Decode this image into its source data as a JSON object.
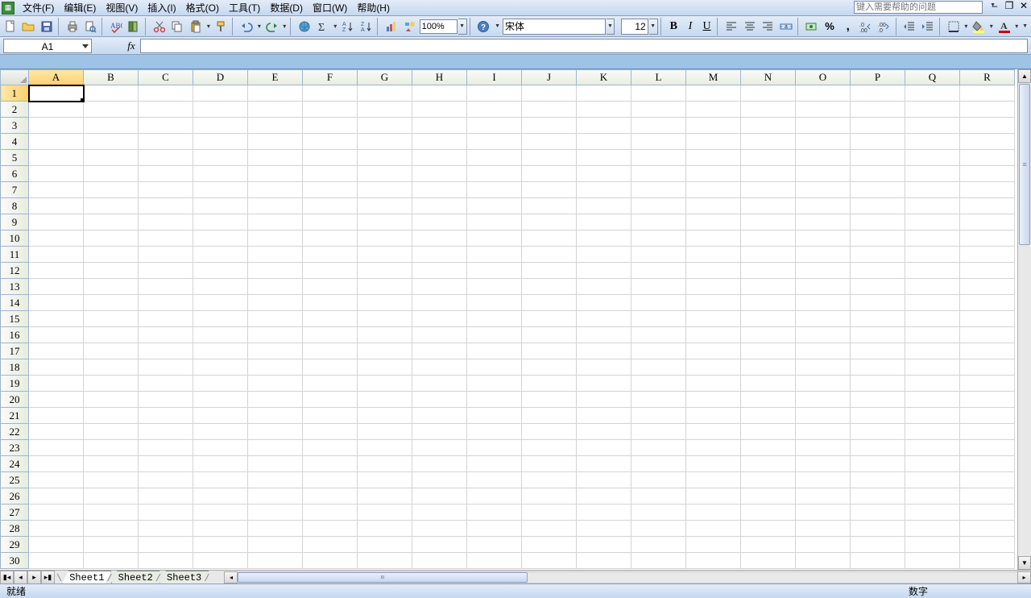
{
  "menu": {
    "items": [
      "文件(F)",
      "编辑(E)",
      "视图(V)",
      "插入(I)",
      "格式(O)",
      "工具(T)",
      "数据(D)",
      "窗口(W)",
      "帮助(H)"
    ],
    "help_placeholder": "键入需要帮助的问题"
  },
  "toolbar": {
    "zoom": "100%",
    "font_name": "宋体",
    "font_size": "12"
  },
  "namebox": {
    "cell": "A1",
    "fx": "fx"
  },
  "grid": {
    "columns": [
      "A",
      "B",
      "C",
      "D",
      "E",
      "F",
      "G",
      "H",
      "I",
      "J",
      "K",
      "L",
      "M",
      "N",
      "O",
      "P",
      "Q",
      "R"
    ],
    "rows": 30,
    "selected": {
      "col": "A",
      "row": 1
    }
  },
  "sheets": {
    "tabs": [
      "Sheet1",
      "Sheet2",
      "Sheet3"
    ],
    "active": 0
  },
  "status": {
    "left": "就绪",
    "right": "数字"
  }
}
